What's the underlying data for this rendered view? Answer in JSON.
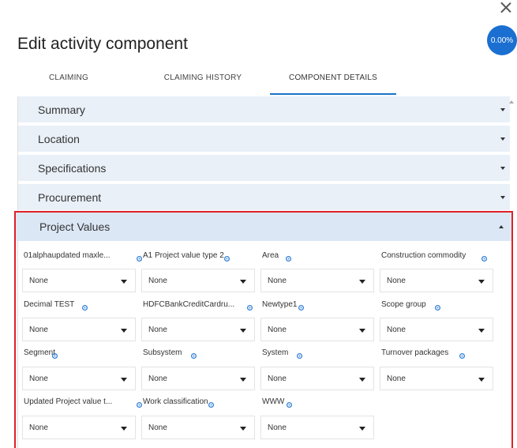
{
  "dialog": {
    "title": "Edit activity component",
    "progress": "0.00%"
  },
  "tabs": [
    {
      "label": "CLAIMING",
      "active": false
    },
    {
      "label": "CLAIMING HISTORY",
      "active": false
    },
    {
      "label": "COMPONENT DETAILS",
      "active": true
    }
  ],
  "sections": [
    {
      "label": "Summary",
      "expanded": false
    },
    {
      "label": "Location",
      "expanded": false
    },
    {
      "label": "Specifications",
      "expanded": false
    },
    {
      "label": "Procurement",
      "expanded": false
    },
    {
      "label": "Project Values",
      "expanded": true
    }
  ],
  "fields": [
    {
      "label": "01alphaupdated maxle...",
      "value": "None"
    },
    {
      "label": "A1 Project value type 2",
      "value": "None"
    },
    {
      "label": "Area",
      "value": "None"
    },
    {
      "label": "Construction commodity",
      "value": "None"
    },
    {
      "label": "Decimal TEST",
      "value": "None"
    },
    {
      "label": "HDFCBankCreditCardru...",
      "value": "None"
    },
    {
      "label": "Newtype1",
      "value": "None"
    },
    {
      "label": "Scope group",
      "value": "None"
    },
    {
      "label": "Segment",
      "value": "None"
    },
    {
      "label": "Subsystem",
      "value": "None"
    },
    {
      "label": "System",
      "value": "None"
    },
    {
      "label": "Turnover packages",
      "value": "None"
    },
    {
      "label": "Updated Project value t...",
      "value": "None"
    },
    {
      "label": "Work classification",
      "value": "None"
    },
    {
      "label": "WWW",
      "value": "None"
    }
  ],
  "colors": {
    "accent": "#1a73c9",
    "badge": "#1a6fd1",
    "section_bg": "#e9f0f8",
    "highlight_border": "#e0202a"
  },
  "icons": {
    "close": "close-icon",
    "field_settings": "gear-icon",
    "dropdown": "chevron-down-icon"
  }
}
